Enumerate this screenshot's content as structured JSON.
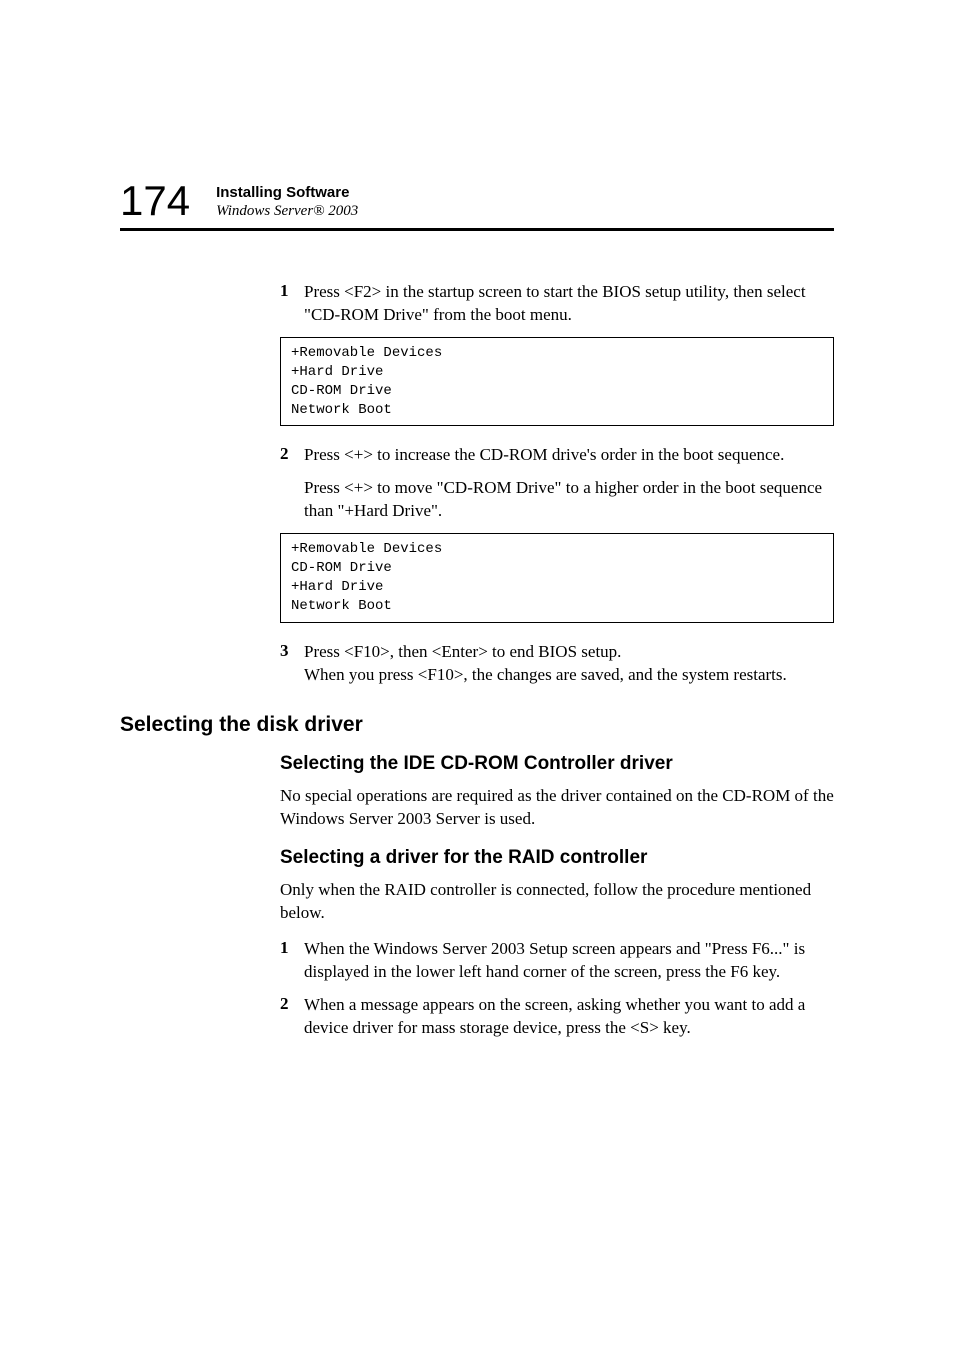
{
  "header": {
    "page_number": "174",
    "title": "Installing Software",
    "subtitle": "Windows Server® 2003"
  },
  "steps_a": {
    "s1": {
      "num": "1",
      "text": "Press <F2> in the startup screen to start the BIOS setup utility, then select \"CD-ROM Drive\" from the boot menu."
    },
    "code1": "+Removable Devices\n+Hard Drive\nCD-ROM Drive\nNetwork Boot",
    "s2": {
      "num": "2",
      "text": "Press <+> to increase the CD-ROM drive's order in the boot sequence."
    },
    "s2_sub": "Press <+> to move \"CD-ROM Drive\" to a higher order in the boot sequence than \"+Hard Drive\".",
    "code2": "+Removable Devices\nCD-ROM Drive\n+Hard Drive\nNetwork Boot",
    "s3": {
      "num": "3",
      "text": "Press <F10>, then <Enter> to end BIOS setup.\nWhen you press <F10>, the changes are saved, and the system restarts."
    }
  },
  "section": {
    "h2": "Selecting the disk driver",
    "h3a": "Selecting the IDE CD-ROM Controller driver",
    "p1": "No special operations are required as the driver contained on the CD-ROM of the Windows Server 2003 Server is used.",
    "h3b": "Selecting a driver for the RAID controller",
    "p2": "Only when the RAID controller is connected, follow the procedure mentioned below.",
    "b1": {
      "num": "1",
      "text": "When the Windows Server 2003 Setup screen appears and \"Press F6...\" is displayed in the lower left hand corner of the screen, press the F6 key."
    },
    "b2": {
      "num": "2",
      "text": "When a message appears on the screen, asking whether you want to add a device driver for mass storage device, press the <S> key."
    }
  }
}
